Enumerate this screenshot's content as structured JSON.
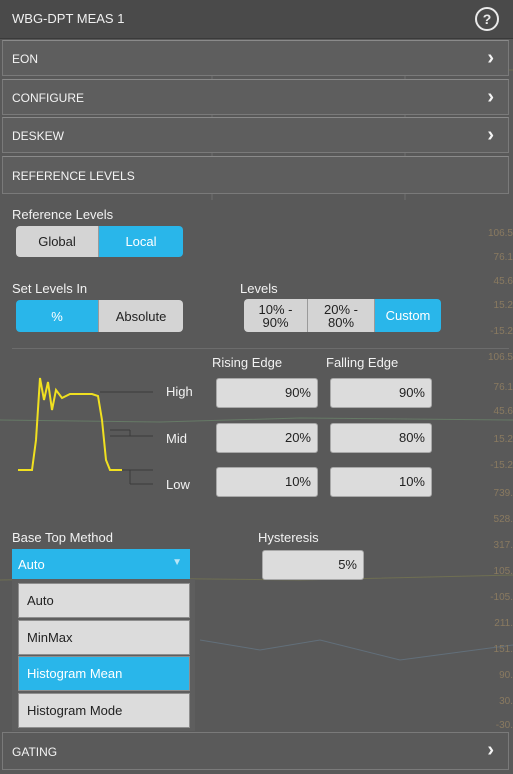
{
  "title": "WBG-DPT MEAS 1",
  "help_glyph": "?",
  "sections": [
    {
      "label": "EON",
      "chevron": "›"
    },
    {
      "label": "CONFIGURE",
      "chevron": "›"
    },
    {
      "label": "DESKEW",
      "chevron": "›"
    },
    {
      "label": "REFERENCE LEVELS"
    }
  ],
  "reference_levels": {
    "label": "Reference Levels",
    "options": [
      "Global",
      "Local"
    ],
    "selected": "Local"
  },
  "set_levels_in": {
    "label": "Set Levels In",
    "options": [
      "%",
      "Absolute"
    ],
    "selected": "%"
  },
  "levels": {
    "label": "Levels",
    "options": [
      "10% -\n90%",
      "20% -\n80%",
      "Custom"
    ],
    "selected": "Custom"
  },
  "edges": {
    "rising_header": "Rising Edge",
    "falling_header": "Falling Edge",
    "rows": [
      {
        "name": "High",
        "rising": "90%",
        "falling": "90%"
      },
      {
        "name": "Mid",
        "rising": "20%",
        "falling": "80%"
      },
      {
        "name": "Low",
        "rising": "10%",
        "falling": "10%"
      }
    ]
  },
  "base_top": {
    "label": "Base Top Method",
    "value": "Auto",
    "arrow": "▼",
    "options": [
      "Auto",
      "MinMax",
      "Histogram Mean",
      "Histogram Mode"
    ],
    "highlighted": "Histogram Mean"
  },
  "hysteresis": {
    "label": "Hysteresis",
    "value": "5%"
  },
  "gating": {
    "label": "GATING",
    "chevron": "›"
  },
  "background_readouts": [
    "106.5",
    "76.1",
    "45.6",
    "15.2",
    "-15.2",
    "106.5",
    "76.1",
    "45.6",
    "15.2",
    "-15.2",
    "739.",
    "528.",
    "317.",
    "105.",
    "-105.",
    "211.",
    "151.",
    "90.",
    "30.",
    "-30."
  ],
  "colors": {
    "accent": "#29b6ea",
    "waveform": "#f0e020"
  }
}
